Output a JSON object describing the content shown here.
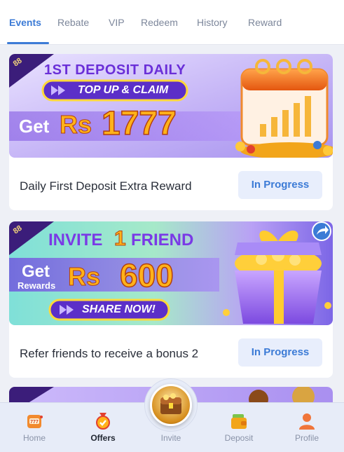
{
  "tabs": [
    {
      "label": "Events",
      "active": true
    },
    {
      "label": "Rebate"
    },
    {
      "label": "VIP"
    },
    {
      "label": "Redeem"
    },
    {
      "label": "History"
    },
    {
      "label": "Reward"
    }
  ],
  "cards": [
    {
      "banner": {
        "badge": "88",
        "headline": "1ST DEPOSIT DAILY",
        "pill": "TOP UP & CLAIM",
        "prefix": "Get",
        "currency": "Rs",
        "amount": "1777"
      },
      "title": "Daily First Deposit Extra Reward",
      "status": "In Progress"
    },
    {
      "banner": {
        "badge": "88",
        "headline_a": "INVITE",
        "headline_num": "1",
        "headline_b": "FRIEND",
        "prefix": "Get",
        "prefix_sub": "Rewards",
        "currency": "Rs",
        "amount": "600",
        "pill": "SHARE NOW!"
      },
      "title": "Refer friends to receive a bonus 2",
      "status": "In Progress"
    }
  ],
  "bottom_nav": [
    {
      "label": "Home",
      "icon": "slot-machine-icon"
    },
    {
      "label": "Offers",
      "icon": "medal-icon",
      "active": true
    },
    {
      "label": "Invite",
      "icon": "treasure-chest-icon"
    },
    {
      "label": "Deposit",
      "icon": "wallet-icon"
    },
    {
      "label": "Profile",
      "icon": "user-icon"
    }
  ],
  "colors": {
    "accent": "#3c7bd6",
    "status_bg": "#e8eefc",
    "banner1_bg": "#c9b6f5",
    "banner2_bg": "#5fd3cf",
    "amount_gold": "#ffb21a"
  }
}
